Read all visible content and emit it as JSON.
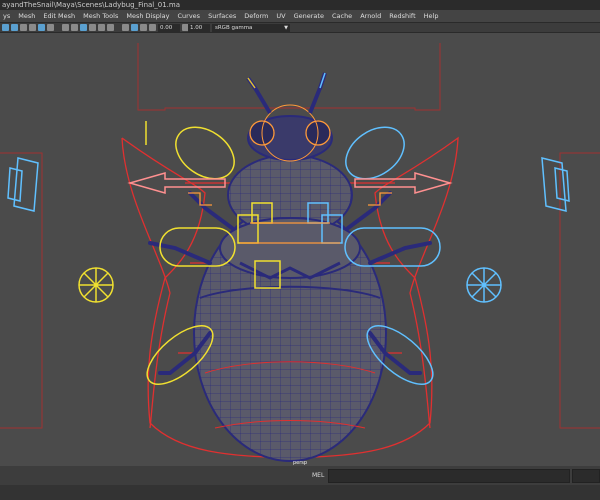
{
  "window": {
    "title": "ayandTheSnail\\Maya\\Scenes\\Ladybug_Final_01.ma"
  },
  "menu": [
    "ys",
    "Mesh",
    "Edit Mesh",
    "Mesh Tools",
    "Mesh Display",
    "Curves",
    "Surfaces",
    "Deform",
    "UV",
    "Generate",
    "Cache",
    "Arnold",
    "Redshift",
    "Help"
  ],
  "toolbar": {
    "field_a": "0.00",
    "field_b": "1.00",
    "colorspace": "sRGB gamma"
  },
  "viewport": {
    "camera": "persp"
  },
  "command_line": {
    "label": "MEL"
  },
  "colors": {
    "mesh_wire": "#2a2a7a",
    "rig_red": "#e03030",
    "ctrl_yellow": "#f0e030",
    "ctrl_blue": "#60c0ff",
    "ctrl_orange": "#ff9a3a",
    "ctrl_pink": "#ff9090"
  }
}
